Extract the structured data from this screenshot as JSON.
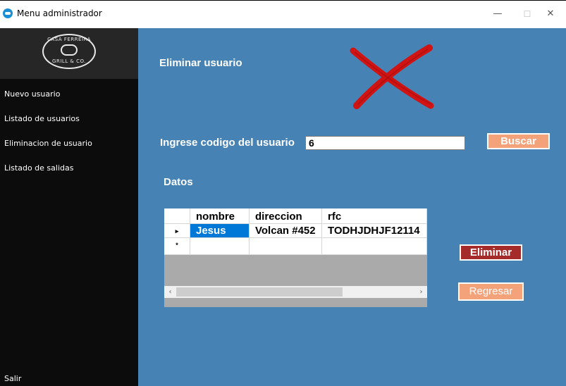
{
  "window": {
    "title": "Menu administrador",
    "min_glyph": "—",
    "max_glyph": "☐",
    "close_glyph": "✕"
  },
  "sidebar": {
    "logo_top_text": "CASA FERREIRA",
    "logo_bottom_text": "GRILL & CO.",
    "items": [
      {
        "label": "Nuevo usuario"
      },
      {
        "label": "Listado de usuarios"
      },
      {
        "label": "Eliminacion de usuario"
      },
      {
        "label": "Listado de salidas"
      }
    ],
    "exit_label": "Salir"
  },
  "main": {
    "title": "Eliminar usuario",
    "illustration_icon": "red-x-icon",
    "search": {
      "label": "Ingrese codigo del usuario",
      "value": "6",
      "button_label": "Buscar"
    },
    "section_label": "Datos",
    "grid": {
      "columns": [
        "nombre",
        "direccion",
        "rfc"
      ],
      "rows": [
        {
          "marker": "▸",
          "cells": [
            "Jesus",
            "Volcan #452",
            "TODHJDHJF12114"
          ],
          "selected_cell": 0
        }
      ],
      "new_row_marker": "*",
      "scroll_left": "‹",
      "scroll_right": "›"
    },
    "eliminar_label": "Eliminar",
    "regresar_label": "Regresar"
  },
  "colors": {
    "sidebar_bg": "#0c0c0c",
    "main_bg": "#4682b4",
    "buscar_bg": "#f4a27a",
    "eliminar_bg": "#a52a2a",
    "selection": "#0078d7",
    "x_mark": "#cc1a1a"
  }
}
